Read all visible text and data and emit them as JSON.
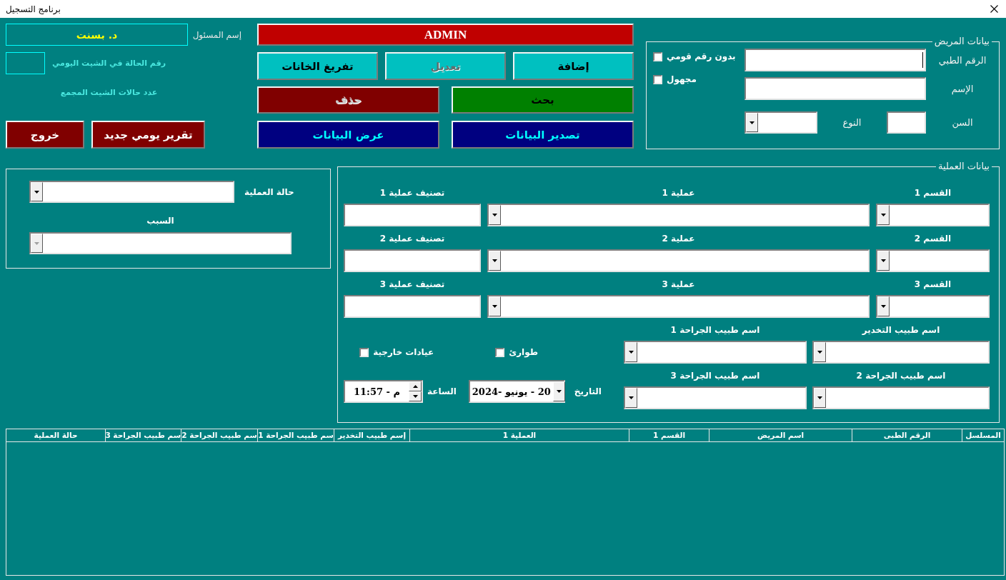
{
  "window": {
    "title": "برنامج التسجيل"
  },
  "patient": {
    "title": "بيانات المريض",
    "fields": [
      {
        "label": "الرقم الطبي",
        "focused": true
      },
      {
        "label": "الإسم",
        "focused": false
      }
    ],
    "age": {
      "label": "السن"
    },
    "gender": {
      "label": "النوع"
    },
    "flags": [
      {
        "label": "بدون رقم قومي",
        "checked": false
      },
      {
        "label": "مجهول",
        "checked": false
      }
    ]
  },
  "banner": {
    "label": "ADMIN"
  },
  "action_rows": [
    {
      "buttons": [
        {
          "label": "إضافة",
          "kind": "form",
          "disabled": false
        },
        {
          "label": "تعديل",
          "kind": "form",
          "disabled": true
        },
        {
          "label": "تفريغ الخانات",
          "kind": "form",
          "disabled": false
        }
      ]
    },
    {
      "buttons": [
        {
          "label": "بحث",
          "kind": "search",
          "disabled": false
        },
        {
          "label": "حذف",
          "kind": "danger",
          "disabled": true
        }
      ]
    },
    {
      "buttons": [
        {
          "label": "تصدير البيانات",
          "kind": "data",
          "disabled": false
        },
        {
          "label": "عرض البيانات",
          "kind": "data",
          "disabled": false
        }
      ]
    }
  ],
  "session": {
    "user_label": "إسم المسئول",
    "user_name": "د. بسنت",
    "case_number_label": "رقم الحالة في الشيت اليومي",
    "total_cases_label": "عدد حالات الشيت المجمع",
    "buttons": [
      {
        "label": "تقرير يومي جديد",
        "kind": "danger",
        "disabled": false
      },
      {
        "label": "خروج",
        "kind": "danger",
        "disabled": false
      }
    ]
  },
  "operation": {
    "title": "بيانات العملية",
    "procedures": [
      {
        "department": "القسم 1",
        "procedure": "عملية 1",
        "classification": "تصنيف عملية 1"
      },
      {
        "department": "القسم 2",
        "procedure": "عملية 2",
        "classification": "تصنيف عملية 2"
      },
      {
        "department": "القسم 3",
        "procedure": "عملية 3",
        "classification": "تصنيف عملية 3"
      }
    ],
    "doctors": [
      "اسم طبيب التخدير",
      "اسم طبيب الجراحة 1",
      "اسم طبيب الجراحة 2",
      "اسم طبيب الجراحة 3"
    ],
    "visit_types": [
      {
        "label": "طوارئ",
        "checked": false
      },
      {
        "label": "عيادات خارجية",
        "checked": false
      }
    ],
    "date": {
      "label": "التاريخ",
      "value": "20 - يونيو -2024"
    },
    "time": {
      "label": "الساعة",
      "value": "م - 11:57"
    }
  },
  "operation_status": {
    "result": {
      "label": "حالة العملية",
      "disabled": false
    },
    "reason": {
      "label": "السبب",
      "disabled": true
    }
  },
  "table": {
    "columns": [
      "المسلسل",
      "الرقم الطبى",
      "اسم المريض",
      "القسم 1",
      "العملية 1",
      "إسم طبيب التخدير",
      "سم طبيب الجراحة 1",
      "سم طبيب الجراحة 2",
      "سم طبيب الجراحة 3",
      "حالة العملية"
    ]
  }
}
